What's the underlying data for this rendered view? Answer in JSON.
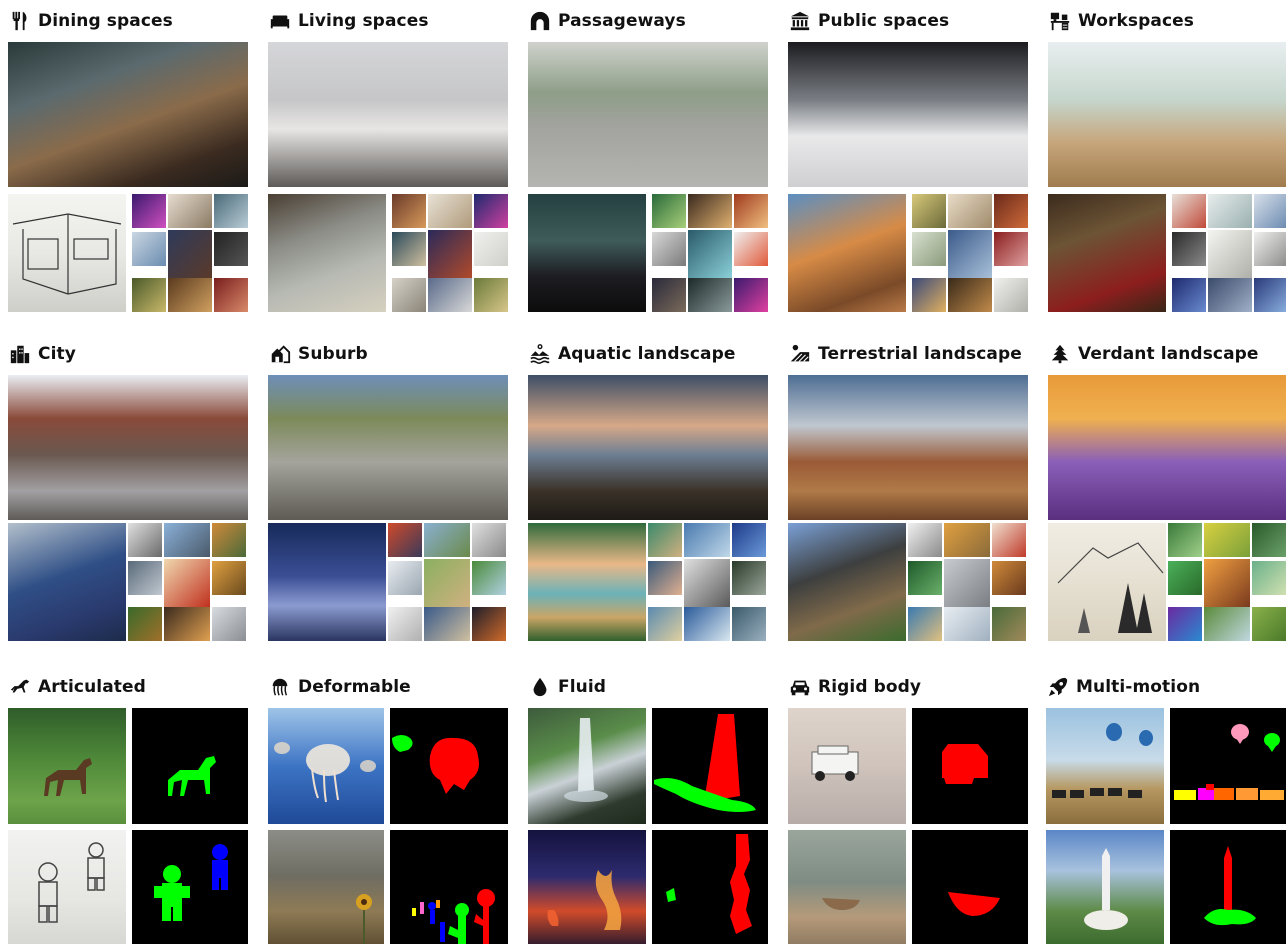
{
  "categories": [
    {
      "title": "Dining spaces",
      "icon": "utensils-icon"
    },
    {
      "title": "Living spaces",
      "icon": "bed-icon"
    },
    {
      "title": "Passageways",
      "icon": "tunnel-icon"
    },
    {
      "title": "Public spaces",
      "icon": "museum-icon"
    },
    {
      "title": "Workspaces",
      "icon": "desk-icon"
    },
    {
      "title": "City",
      "icon": "city-icon"
    },
    {
      "title": "Suburb",
      "icon": "house-icon"
    },
    {
      "title": "Aquatic landscape",
      "icon": "water-icon"
    },
    {
      "title": "Terrestrial landscape",
      "icon": "field-icon"
    },
    {
      "title": "Verdant landscape",
      "icon": "tree-icon"
    },
    {
      "title": "Articulated",
      "icon": "horse-icon"
    },
    {
      "title": "Deformable",
      "icon": "jellyfish-icon"
    },
    {
      "title": "Fluid",
      "icon": "droplet-icon"
    },
    {
      "title": "Rigid body",
      "icon": "car-icon"
    },
    {
      "title": "Multi-motion",
      "icon": "rocket-icon"
    }
  ],
  "colors": {
    "mask_background": "#000000",
    "mask_red": "#ff0000",
    "mask_green": "#00ff00",
    "mask_blue": "#0000ff",
    "mask_yellow": "#ffff00",
    "mask_pink": "#ff66cc",
    "mask_orange": "#ff9900"
  }
}
